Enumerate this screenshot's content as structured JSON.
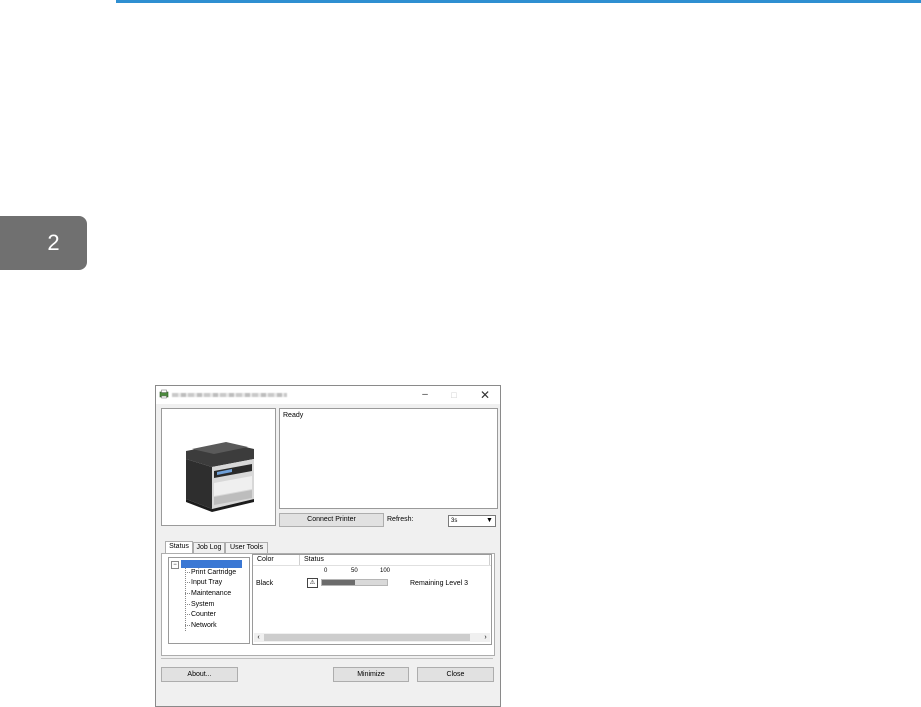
{
  "page": {
    "chapter_number": "2",
    "accent_color": "#2f8fd1"
  },
  "window": {
    "title": "",
    "controls": {
      "minimize": "–",
      "maximize": "□",
      "close": "✕"
    }
  },
  "status_area": {
    "message": "Ready"
  },
  "controls": {
    "connect_label": "Connect Printer",
    "refresh_label": "Refresh:",
    "refresh_value": "3s"
  },
  "tabs": [
    {
      "label": "Status",
      "active": true
    },
    {
      "label": "Job Log",
      "active": false
    },
    {
      "label": "User Tools",
      "active": false
    }
  ],
  "tree": {
    "expander": "−",
    "items": [
      "Print Cartridge",
      "Input Tray",
      "Maintenance",
      "System",
      "Counter",
      "Network"
    ]
  },
  "table": {
    "headers": [
      "Color",
      "Status"
    ],
    "scale_labels": [
      "0",
      "50",
      "100"
    ],
    "rows": [
      {
        "color": "Black",
        "level_percent": 50,
        "remaining": "Remaining Level 3"
      }
    ]
  },
  "buttons": {
    "about": "About...",
    "minimize": "Minimize",
    "close": "Close"
  }
}
